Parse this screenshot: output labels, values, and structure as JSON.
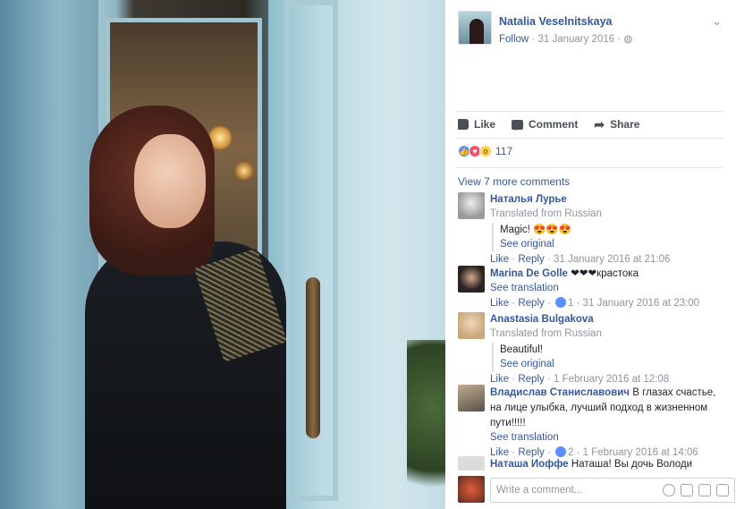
{
  "post": {
    "author": "Natalia Veselnitskaya",
    "follow": "Follow",
    "date": "31 January 2016",
    "privacy_icon": "globe-icon",
    "photo_description": "woman-at-blue-door"
  },
  "actions": {
    "like": "Like",
    "comment": "Comment",
    "share": "Share"
  },
  "reactions": {
    "types": [
      "like",
      "love",
      "wow"
    ],
    "count": "117"
  },
  "view_more": "View 7 more comments",
  "comments": [
    {
      "name": "Наталья Лурье",
      "translated": "Translated from Russian",
      "text": "Magic! 😍😍😍",
      "see_original": "See original",
      "like": "Like",
      "reply": "Reply",
      "time": "31 January 2016 at 21:06"
    },
    {
      "name": "Marina De Golle",
      "text": "❤❤❤краcтока",
      "see_translation": "See translation",
      "like": "Like",
      "reply": "Reply",
      "likes": "1",
      "time": "31 January 2016 at 23:00"
    },
    {
      "name": "Anastasia Bulgakova",
      "translated": "Translated from Russian",
      "text": "Beautiful!",
      "see_original": "See original",
      "like": "Like",
      "reply": "Reply",
      "time": "1 February 2016 at 12:08"
    },
    {
      "name": "Владислав Станиславович",
      "text": "В глазах счастье, на лице улыбка, лучший подход в жизненном пути!!!!!",
      "see_translation": "See translation",
      "like": "Like",
      "reply": "Reply",
      "likes": "2",
      "time": "1 February 2016 at 14:06"
    },
    {
      "name": "Наташа Иоффе",
      "text": "Наташа! Вы дочь Володи"
    }
  ],
  "composer": {
    "placeholder": "Write a comment..."
  }
}
